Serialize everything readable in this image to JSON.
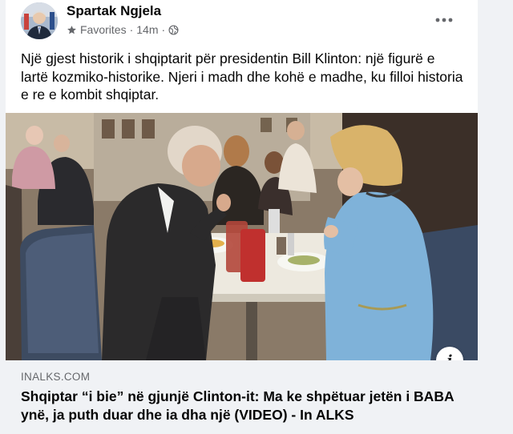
{
  "post": {
    "author": "Spartak Ngjela",
    "audience": "Favorites",
    "separator": "·",
    "time": "14m",
    "separator2": "·",
    "text": "Një gjest historik i shqiptarit për presidentin Bill Klinton: një figurë e lartë kozmiko-historike. Njeri i madh dhe kohë e madhe, ku filloi historia e re e kombit shqiptar."
  },
  "link_preview": {
    "domain": "INALKS.COM",
    "title": "Shqiptar “i bie” në gjunjë Clinton-it: Ma ke shpëtuar jetën i BABA ynë, ja puth duar dhe ia dha një (VIDEO) - In ALKS",
    "info_glyph": "i"
  },
  "icons": {
    "avatar": "avatar",
    "favorites": "star-icon",
    "audience": "globe-icon",
    "more": "more-options-icon",
    "info": "info-icon"
  },
  "colors": {
    "text_primary": "#050505",
    "text_secondary": "#65676b",
    "background": "#f0f2f5",
    "card": "#ffffff",
    "coat_blue": "#7fb2d9"
  }
}
